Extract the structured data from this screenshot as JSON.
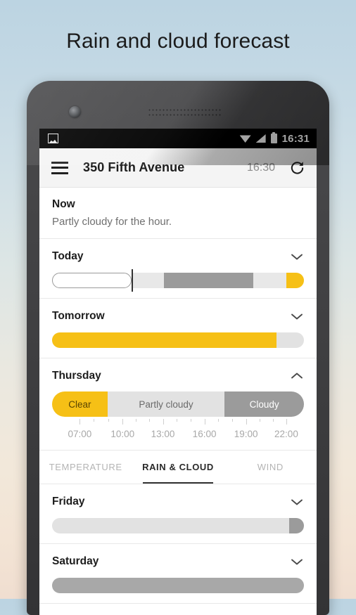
{
  "page": {
    "title": "Rain and cloud forecast"
  },
  "status_bar": {
    "notification_icon": "photo-icon",
    "wifi_icon": "wifi-icon",
    "signal_icon": "signal-icon",
    "battery_icon": "battery-icon",
    "time": "16:31"
  },
  "app_bar": {
    "menu_icon": "hamburger-icon",
    "location": "350 Fifth Avenue",
    "updated_time": "16:30",
    "refresh_icon": "refresh-icon"
  },
  "now": {
    "title": "Now",
    "description": "Partly cloudy for the hour."
  },
  "days": [
    {
      "name": "Today",
      "expanded": false,
      "chevron": "chevron-down-icon"
    },
    {
      "name": "Tomorrow",
      "expanded": false,
      "chevron": "chevron-down-icon"
    },
    {
      "name": "Thursday",
      "expanded": true,
      "chevron": "chevron-up-icon"
    },
    {
      "name": "Friday",
      "expanded": false,
      "chevron": "chevron-down-icon"
    },
    {
      "name": "Saturday",
      "expanded": false,
      "chevron": "chevron-down-icon"
    }
  ],
  "thursday_segments": [
    {
      "label": "Clear",
      "color": "#f6c016",
      "text_color": "#5a4400",
      "width_pct": 22.0
    },
    {
      "label": "Partly cloudy",
      "color": "#e2e2e2",
      "text_color": "#6a6a6a",
      "width_pct": 46.5
    },
    {
      "label": "Cloudy",
      "color": "#9b9b9b",
      "text_color": "#ffffff",
      "width_pct": 31.5
    }
  ],
  "thursday_axis": {
    "labels": [
      "07:00",
      "10:00",
      "13:00",
      "16:00",
      "19:00",
      "22:00"
    ],
    "label_positions_pct": [
      11.0,
      28.0,
      44.0,
      60.5,
      77.0,
      93.0
    ]
  },
  "tabs": [
    {
      "label": "TEMPERATURE",
      "active": false
    },
    {
      "label": "RAIN & CLOUD",
      "active": true
    },
    {
      "label": "WIND",
      "active": false
    }
  ],
  "colors": {
    "accent_yellow": "#f6c016",
    "light_gray": "#e2e2e2",
    "mid_gray": "#9b9b9b",
    "dark_text": "#1c1c1c",
    "muted_text": "#6f6f6f"
  },
  "chart_data": {
    "type": "bar",
    "title": "Rain and cloud forecast",
    "description": "Horizontal cloud-cover timeline bars, one per day",
    "legend": [
      "Clear (yellow)",
      "Partly cloudy (light gray)",
      "Cloudy (dark gray)"
    ],
    "series": [
      {
        "name": "Today",
        "past_fraction_pct": 31.5,
        "segments": [
          {
            "state": "past",
            "color": "#ffffff",
            "start_pct": 0.0,
            "end_pct": 31.5
          },
          {
            "state": "partly cloudy",
            "color": "#e8e8e8",
            "start_pct": 31.5,
            "end_pct": 44.5
          },
          {
            "state": "cloudy",
            "color": "#9b9b9b",
            "start_pct": 44.5,
            "end_pct": 80.0
          },
          {
            "state": "partly cloudy",
            "color": "#e8e8e8",
            "start_pct": 80.0,
            "end_pct": 93.0
          },
          {
            "state": "clear",
            "color": "#f6c016",
            "start_pct": 93.0,
            "end_pct": 100.0
          }
        ]
      },
      {
        "name": "Tomorrow",
        "segments": [
          {
            "state": "clear",
            "color": "#f6c016",
            "start_pct": 0.0,
            "end_pct": 89.0
          },
          {
            "state": "partly cloudy",
            "color": "#e2e2e2",
            "start_pct": 89.0,
            "end_pct": 100.0
          }
        ]
      },
      {
        "name": "Thursday",
        "segments": [
          {
            "state": "clear",
            "color": "#f6c016",
            "start_pct": 0.0,
            "end_pct": 22.0
          },
          {
            "state": "partly cloudy",
            "color": "#e2e2e2",
            "start_pct": 22.0,
            "end_pct": 68.5
          },
          {
            "state": "cloudy",
            "color": "#9b9b9b",
            "start_pct": 68.5,
            "end_pct": 100.0
          }
        ],
        "axis_ticks": [
          "07:00",
          "10:00",
          "13:00",
          "16:00",
          "19:00",
          "22:00"
        ]
      },
      {
        "name": "Friday",
        "segments": [
          {
            "state": "partly cloudy",
            "color": "#e2e2e2",
            "start_pct": 0.0,
            "end_pct": 94.0
          },
          {
            "state": "cloudy",
            "color": "#9b9b9b",
            "start_pct": 94.0,
            "end_pct": 100.0
          }
        ]
      },
      {
        "name": "Saturday",
        "segments": [
          {
            "state": "cloudy",
            "color": "#a8a8a8",
            "start_pct": 0.0,
            "end_pct": 100.0
          }
        ]
      }
    ]
  }
}
